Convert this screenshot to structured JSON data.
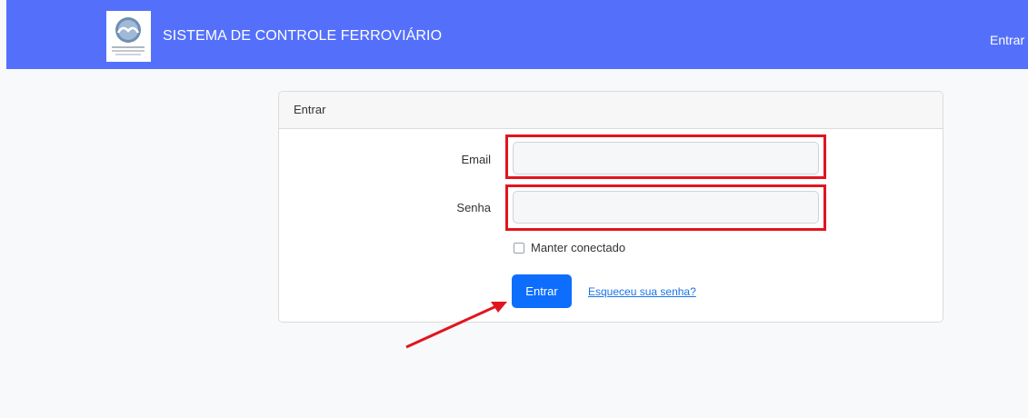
{
  "navbar": {
    "brand": "SISTEMA DE CONTROLE FERROVIÁRIO",
    "login_link": "Entrar",
    "color": "#5470fb"
  },
  "card": {
    "header": "Entrar",
    "email_label": "Email",
    "email_value": "",
    "password_label": "Senha",
    "password_value": "",
    "remember_label": "Manter conectado",
    "remember_checked": false,
    "submit_label": "Entrar",
    "forgot_link": "Esqueceu sua senha?"
  },
  "annotations": {
    "highlight_color": "#e0161e",
    "arrow_color": "#e0161e",
    "icon": "red-arrow-icon"
  },
  "colors": {
    "button": "#0d6efd",
    "link": "#1a73e8",
    "background": "#f8f9fa"
  }
}
